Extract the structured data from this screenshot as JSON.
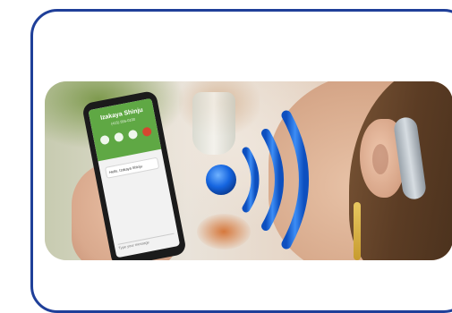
{
  "phone": {
    "caller_name": "Izakaya Shinju",
    "caller_sub": "(415) 555-0100",
    "message_text": "Hello, Izakaya Shinju",
    "input_placeholder": "Type your message"
  },
  "colors": {
    "card_border": "#1f3f99",
    "call_header": "#5fa844",
    "wave_blue": "#1565e0"
  },
  "icons": {
    "waves": "sound-waves-icon",
    "hearing_aid": "hearing-aid-icon"
  }
}
